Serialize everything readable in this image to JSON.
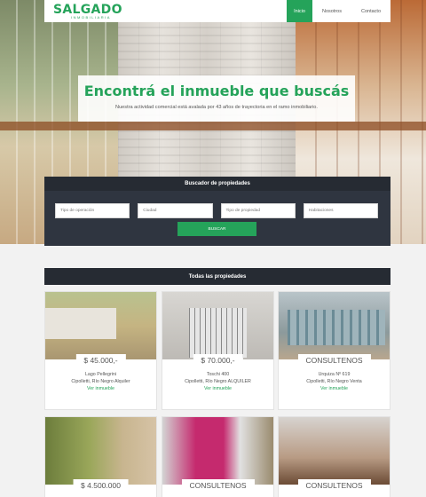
{
  "header": {
    "logo_main": "SALGADO",
    "logo_sub": "INMOBILIARIA",
    "nav": [
      "Inicio",
      "Nosotros",
      "Contacto"
    ]
  },
  "hero": {
    "title": "Encontrá el inmueble que buscás",
    "subtitle": "Nuestra actividad comercial está avalada por 43 años de trayectoria en el ramo inmobiliario."
  },
  "search": {
    "title": "Buscador de propiedades",
    "fields": [
      "Tipo de operación",
      "Ciudad",
      "Tipo de propiedad",
      "Habitaciones"
    ],
    "button": "BUSCAR"
  },
  "properties": {
    "title": "Todas las propiedades",
    "items": [
      {
        "price": "$ 45.000,-",
        "address": "Lago Pellegrini",
        "location": "Cipolletti, Río Negro Alquiler",
        "link": "Ver inmueble"
      },
      {
        "price": "$ 70.000,-",
        "address": "Toschi 400",
        "location": "Cipolletti, Río Negro ALQUILER",
        "link": "Ver inmueble"
      },
      {
        "price": "CONSULTENOS",
        "address": "Urquiza Nº 619",
        "location": "Cipolletti, Río Negro Venta",
        "link": "Ver inmueble"
      },
      {
        "price": "$ 4.500.000"
      },
      {
        "price": "CONSULTENOS"
      },
      {
        "price": "CONSULTENOS"
      }
    ]
  },
  "colors": {
    "accent": "#25a35a",
    "dark": "#262b33"
  }
}
